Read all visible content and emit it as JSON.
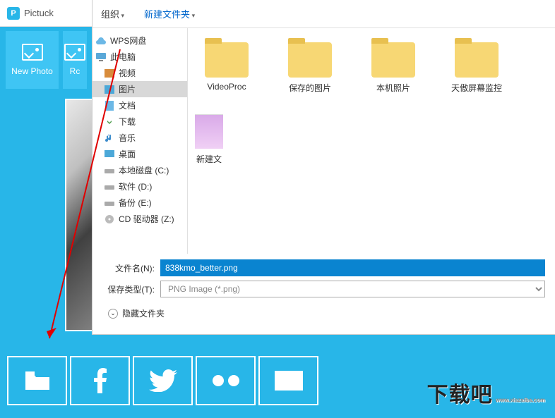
{
  "app": {
    "name": "Pictuck"
  },
  "left": {
    "newphoto": "New Photo",
    "second": "Rc"
  },
  "toolbar": {
    "organize": "组织",
    "newfolder": "新建文件夹"
  },
  "tree": {
    "wps": "WPS网盘",
    "thispc": "此电脑",
    "video": "视频",
    "pictures": "图片",
    "documents": "文档",
    "downloads": "下载",
    "music": "音乐",
    "desktop": "桌面",
    "drivec": "本地磁盘 (C:)",
    "drived": "软件 (D:)",
    "drivee": "备份 (E:)",
    "cddrive": "CD 驱动器 (Z:)"
  },
  "folders": {
    "f1": "VideoProc",
    "f2": "保存的图片",
    "f3": "本机照片",
    "f4": "天傲屏幕监控",
    "f5": "新建文"
  },
  "save": {
    "fname_label": "文件名(N):",
    "fname_value": "838kmo_better.png",
    "ftype_label": "保存类型(T):",
    "ftype_value": "PNG Image (*.png)",
    "hide": "隐藏文件夹"
  },
  "watermark": {
    "cn": "下载吧",
    "dom": "www.xiazaiba.com"
  }
}
